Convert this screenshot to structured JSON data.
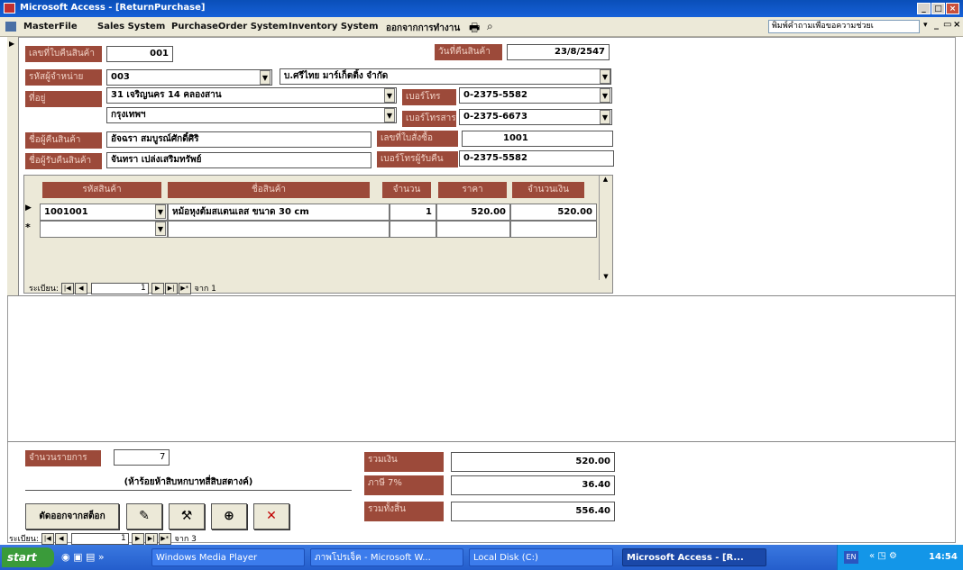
{
  "window": {
    "title": "Microsoft Access - [ReturnPurchase]",
    "controls": [
      "_",
      "□",
      "×"
    ]
  },
  "menubar": {
    "items": [
      "MasterFile",
      "Sales System",
      "PurchaseOrder System",
      "Inventory System",
      "ออกจากการทำงาน"
    ],
    "help_placeholder": "พิมพ์คำถามเพื่อขอความช่วยเ"
  },
  "form": {
    "doc_no_label": "เลขที่ใบคืนสินค้า",
    "doc_no_value": "001",
    "date_label": "วันที่คืนสินค้า",
    "date_value": "23/8/2547",
    "supplier_code_label": "รหัสผู้จำหน่าย",
    "supplier_code_value": "003",
    "supplier_name_value": "บ.ศรีไทย มาร์เก็ตติ้ง จำกัด",
    "address_label": "ที่อยู่",
    "address_line1": "31 เจริญนคร 14 คลองสาน",
    "address_line2": "กรุงเทพฯ",
    "phone_label": "เบอร์โทร",
    "phone_value": "0-2375-5582",
    "fax_label": "เบอร์โทรสาร",
    "fax_value": "0-2375-6673",
    "return_by_label": "ชื่อผู้คืนสินค้า",
    "return_by_value": "อัจฉรา สมบูรณ์ศักดิ์ศิริ",
    "receiver_label": "ชื่อผู้รับคืนสินค้า",
    "receiver_value": "จันทรา เปล่งเสริมทรัพย์",
    "purchase_order_label": "เลขที่ใบสั่งซื้อ",
    "purchase_order_value": "1001",
    "receiver_phone_label": "เบอร์โทรผู้รับคืน",
    "receiver_phone_value": "0-2375-5582"
  },
  "subform": {
    "columns": [
      "รหัสสินค้า",
      "ชื่อสินค้า",
      "จำนวน",
      "ราคา",
      "จำนวนเงิน"
    ],
    "rows": [
      {
        "code": "1001001",
        "name": "หม้อหุงต้มสแตนเลส ขนาด 30 cm",
        "qty": "1",
        "price": "520.00",
        "amount": "520.00"
      }
    ],
    "new_row_marker": "*",
    "nav_label": "ระเบียน:",
    "nav_current": "1",
    "nav_total": "จาก 1"
  },
  "footer": {
    "count_label": "จำนวนรายการ",
    "count_value": "7",
    "amount_text": "(ห้าร้อยห้าสิบหกบาทสี่สิบสตางค์)",
    "subtotal_label": "รวมเงิน",
    "subtotal_value": "520.00",
    "vat_label": "ภาษี 7%",
    "vat_value": "36.40",
    "total_label": "รวมทั้งสิ้น",
    "total_value": "556.40",
    "cut_stock_label": "ตัดออกจากสต็อก",
    "nav_label": "ระเบียน:",
    "nav_current": "1",
    "nav_total": "จาก 3"
  },
  "taskbar": {
    "start_label": "start",
    "items": [
      "Windows Media Player",
      "ภาพโปรเจ็ค - Microsoft W...",
      "Local Disk (C:)",
      "Microsoft Access - [R..."
    ],
    "lang": "EN",
    "clock": "14:54"
  }
}
